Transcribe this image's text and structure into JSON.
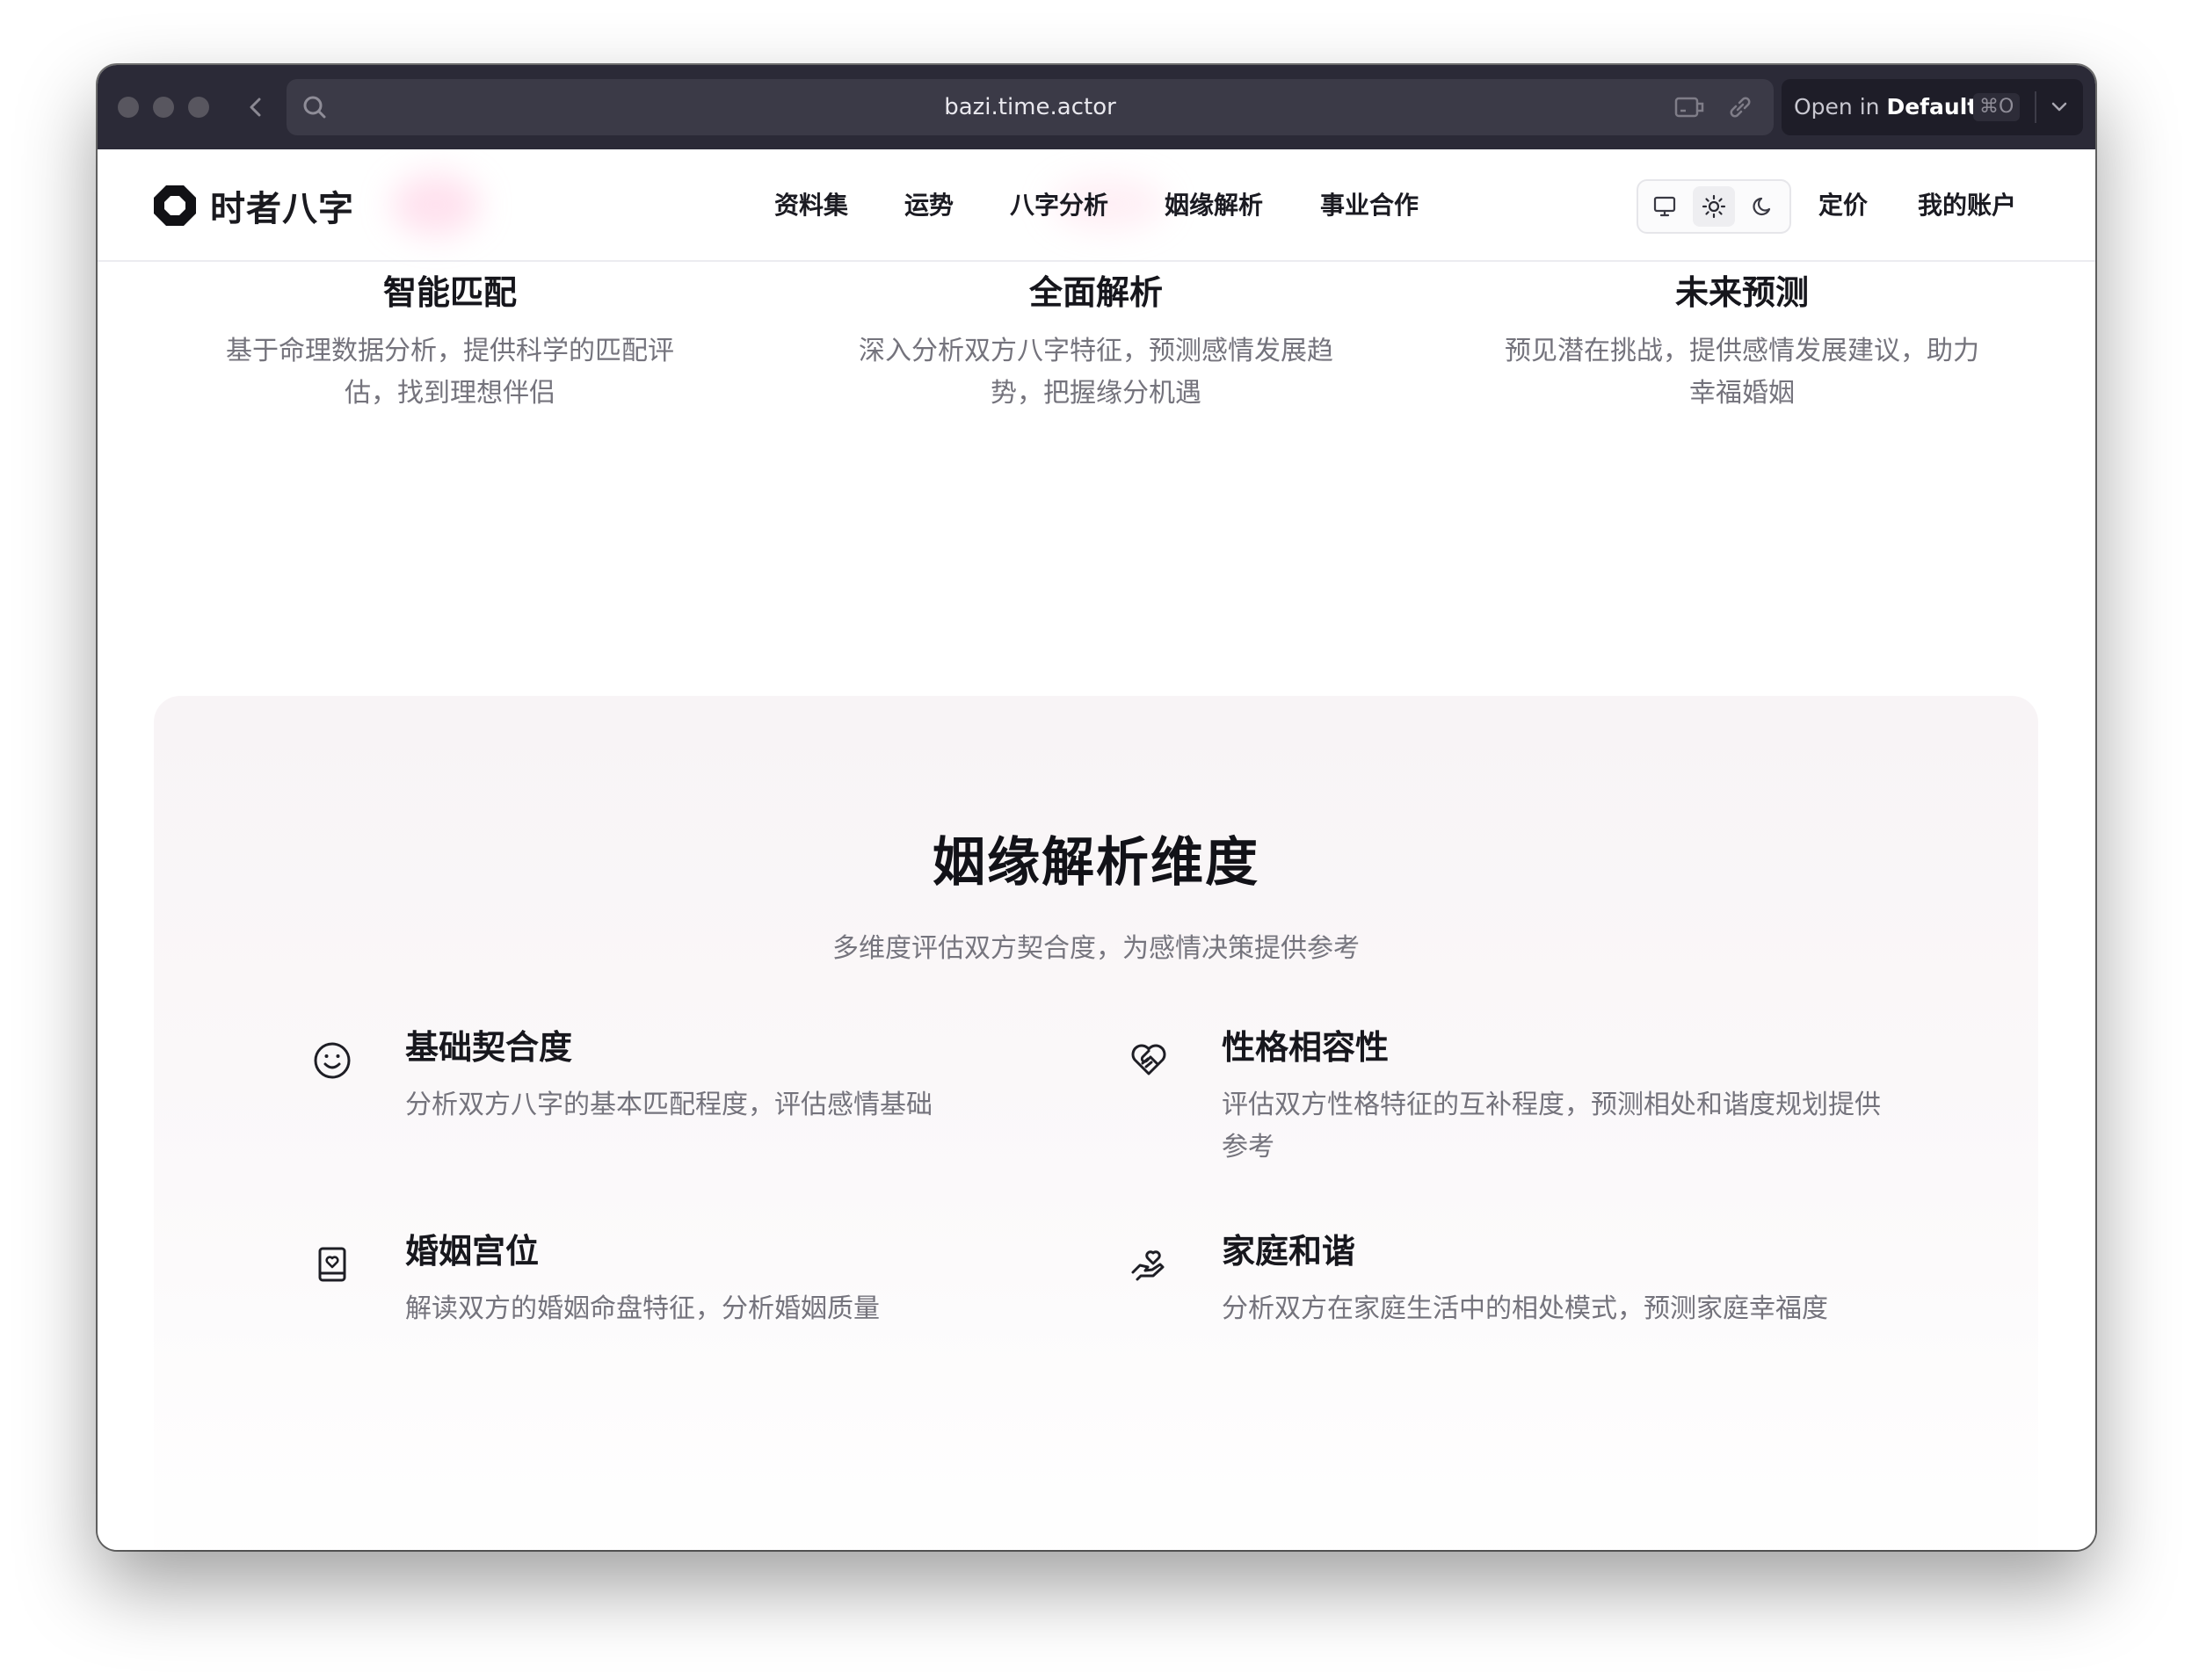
{
  "browser": {
    "url": "bazi.time.actor",
    "open_in_prefix": "Open in",
    "open_in_target": "Default",
    "shortcut": "⌘O"
  },
  "nav": {
    "logo_text": "时者八字",
    "links": [
      "资料集",
      "运势",
      "八字分析",
      "姻缘解析",
      "事业合作"
    ],
    "pricing": "定价",
    "account": "我的账户",
    "theme_options": [
      "monitor-icon",
      "sun-icon",
      "moon-icon"
    ],
    "active_theme": "sun-icon"
  },
  "features": [
    {
      "title": "智能匹配",
      "desc": "基于命理数据分析，提供科学的匹配评估，找到理想伴侣"
    },
    {
      "title": "全面解析",
      "desc": "深入分析双方八字特征，预测感情发展趋势，把握缘分机遇"
    },
    {
      "title": "未来预测",
      "desc": "预见潜在挑战，提供感情发展建议，助力幸福婚姻"
    }
  ],
  "dimensions": {
    "title": "姻缘解析维度",
    "subtitle": "多维度评估双方契合度，为感情决策提供参考",
    "items": [
      {
        "icon": "smile-icon",
        "title": "基础契合度",
        "desc": "分析双方八字的基本匹配程度，评估感情基础"
      },
      {
        "icon": "heart-handshake-icon",
        "title": "性格相容性",
        "desc": "评估双方性格特征的互补程度，预测相处和谐度规划提供参考"
      },
      {
        "icon": "book-heart-icon",
        "title": "婚姻宫位",
        "desc": "解读双方的婚姻命盘特征，分析婚姻质量"
      },
      {
        "icon": "hand-heart-icon",
        "title": "家庭和谐",
        "desc": "分析双方在家庭生活中的相处模式，预测家庭幸福度"
      }
    ]
  },
  "colors": {
    "titlebar": "#2b2a37",
    "card_bg": "#f8f4f6",
    "text_primary": "#16161c",
    "text_secondary": "#74737c"
  }
}
